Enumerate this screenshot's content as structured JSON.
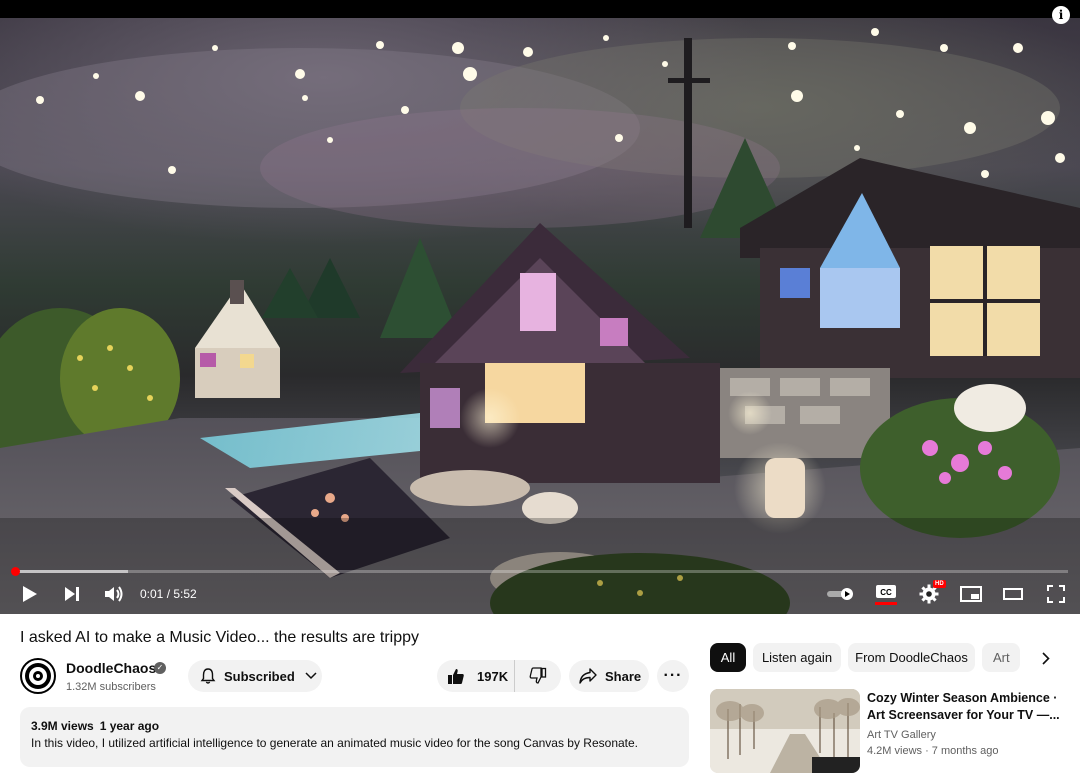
{
  "player": {
    "time_current": "0:01",
    "time_separator": " / ",
    "time_total": "5:52",
    "progress_played": 0.003,
    "progress_loaded": 0.11,
    "hd_badge": "HD",
    "icons": [
      "info-icon",
      "play-icon",
      "next-icon",
      "volume-icon",
      "autoplay-toggle-icon",
      "captions-icon",
      "settings-icon",
      "miniplayer-icon",
      "theater-icon",
      "fullscreen-icon"
    ]
  },
  "video": {
    "title": "I asked AI to make a Music Video... the results are trippy"
  },
  "channel": {
    "name": "DoodleChaos",
    "subscribers": "1.32M subscribers",
    "subscribed_label": "Subscribed"
  },
  "actions": {
    "like_count": "197K",
    "share_label": "Share",
    "more_label": "···"
  },
  "description": {
    "views": "3.9M views",
    "date": "1 year ago",
    "text": "In this video, I utilized artificial intelligence to generate an animated music video for the song Canvas by Resonate."
  },
  "chips": [
    {
      "label": "All",
      "active": true
    },
    {
      "label": "Listen again",
      "active": false
    },
    {
      "label": "From DoodleChaos",
      "active": false
    },
    {
      "label": "Art",
      "active": false
    }
  ],
  "recommendation": {
    "title_line1": "Cozy Winter Season Ambience ·",
    "title_line2": "Art Screensaver for Your TV —...",
    "channel": "Art TV Gallery",
    "meta": "4.2M views · 7 months ago"
  },
  "colors": {
    "accent": "#ff0000",
    "chip_bg": "#f2f2f2",
    "chip_active_bg": "#0f0f0f",
    "secondary_text": "#606060"
  }
}
